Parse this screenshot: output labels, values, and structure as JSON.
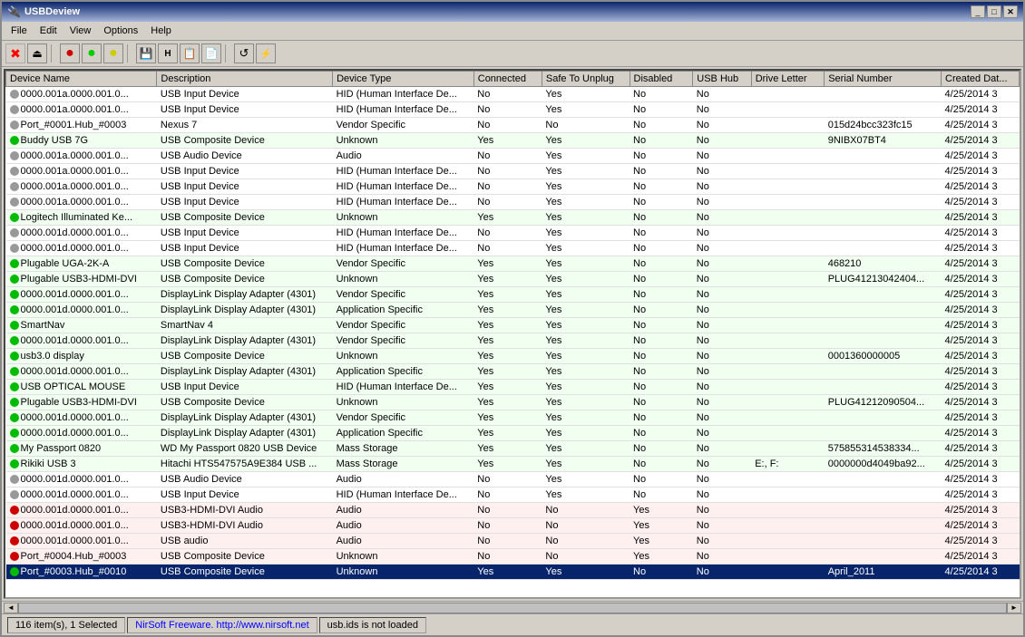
{
  "window": {
    "title": "USBDeview",
    "icon": "💾"
  },
  "menus": [
    "File",
    "Edit",
    "View",
    "Options",
    "Help"
  ],
  "toolbar": {
    "buttons": [
      {
        "icon": "✖",
        "name": "close-btn",
        "color": "red"
      },
      {
        "icon": "⏏",
        "name": "eject-btn"
      },
      {
        "icon": "⚫",
        "name": "dot-red",
        "color": "#cc0000"
      },
      {
        "icon": "⚫",
        "name": "dot-green",
        "color": "#00cc00"
      },
      {
        "icon": "⚫",
        "name": "dot-yellow",
        "color": "#cccc00"
      },
      {
        "icon": "💾",
        "name": "save-btn"
      },
      {
        "icon": "📄",
        "name": "html-btn"
      },
      {
        "icon": "📋",
        "name": "copy-btn"
      },
      {
        "icon": "📊",
        "name": "report-btn"
      },
      {
        "icon": "🔍",
        "name": "find-btn"
      },
      {
        "icon": "🔌",
        "name": "usb-btn"
      },
      {
        "icon": "📦",
        "name": "package-btn"
      }
    ]
  },
  "columns": [
    "Device Name",
    "Description",
    "Device Type",
    "Connected",
    "Safe To Unplug",
    "Disabled",
    "USB Hub",
    "Drive Letter",
    "Serial Number",
    "Created Dat..."
  ],
  "rows": [
    {
      "dot": "gray",
      "name": "0000.001a.0000.001.0...",
      "desc": "USB Input Device",
      "type": "HID (Human Interface De...",
      "connected": "No",
      "safe": "Yes",
      "disabled": "No",
      "hub": "No",
      "drive": "",
      "serial": "",
      "created": "4/25/2014 3"
    },
    {
      "dot": "gray",
      "name": "0000.001a.0000.001.0...",
      "desc": "USB Input Device",
      "type": "HID (Human Interface De...",
      "connected": "No",
      "safe": "Yes",
      "disabled": "No",
      "hub": "No",
      "drive": "",
      "serial": "",
      "created": "4/25/2014 3"
    },
    {
      "dot": "gray",
      "name": "Port_#0001.Hub_#0003",
      "desc": "Nexus 7",
      "type": "Vendor Specific",
      "connected": "No",
      "safe": "No",
      "disabled": "No",
      "hub": "No",
      "drive": "",
      "serial": "015d24bcc323fc15",
      "created": "4/25/2014 3"
    },
    {
      "dot": "green",
      "name": "Buddy USB 7G",
      "desc": "USB Composite Device",
      "type": "Unknown",
      "connected": "Yes",
      "safe": "Yes",
      "disabled": "No",
      "hub": "No",
      "drive": "",
      "serial": "9NIBX07BT4",
      "created": "4/25/2014 3"
    },
    {
      "dot": "gray",
      "name": "0000.001a.0000.001.0...",
      "desc": "USB Audio Device",
      "type": "Audio",
      "connected": "No",
      "safe": "Yes",
      "disabled": "No",
      "hub": "No",
      "drive": "",
      "serial": "",
      "created": "4/25/2014 3"
    },
    {
      "dot": "gray",
      "name": "0000.001a.0000.001.0...",
      "desc": "USB Input Device",
      "type": "HID (Human Interface De...",
      "connected": "No",
      "safe": "Yes",
      "disabled": "No",
      "hub": "No",
      "drive": "",
      "serial": "",
      "created": "4/25/2014 3"
    },
    {
      "dot": "gray",
      "name": "0000.001a.0000.001.0...",
      "desc": "USB Input Device",
      "type": "HID (Human Interface De...",
      "connected": "No",
      "safe": "Yes",
      "disabled": "No",
      "hub": "No",
      "drive": "",
      "serial": "",
      "created": "4/25/2014 3"
    },
    {
      "dot": "gray",
      "name": "0000.001a.0000.001.0...",
      "desc": "USB Input Device",
      "type": "HID (Human Interface De...",
      "connected": "No",
      "safe": "Yes",
      "disabled": "No",
      "hub": "No",
      "drive": "",
      "serial": "",
      "created": "4/25/2014 3"
    },
    {
      "dot": "green",
      "name": "Logitech Illuminated Ke...",
      "desc": "USB Composite Device",
      "type": "Unknown",
      "connected": "Yes",
      "safe": "Yes",
      "disabled": "No",
      "hub": "No",
      "drive": "",
      "serial": "",
      "created": "4/25/2014 3"
    },
    {
      "dot": "gray",
      "name": "0000.001d.0000.001.0...",
      "desc": "USB Input Device",
      "type": "HID (Human Interface De...",
      "connected": "No",
      "safe": "Yes",
      "disabled": "No",
      "hub": "No",
      "drive": "",
      "serial": "",
      "created": "4/25/2014 3"
    },
    {
      "dot": "gray",
      "name": "0000.001d.0000.001.0...",
      "desc": "USB Input Device",
      "type": "HID (Human Interface De...",
      "connected": "No",
      "safe": "Yes",
      "disabled": "No",
      "hub": "No",
      "drive": "",
      "serial": "",
      "created": "4/25/2014 3"
    },
    {
      "dot": "green",
      "name": "Plugable UGA-2K-A",
      "desc": "USB Composite Device",
      "type": "Vendor Specific",
      "connected": "Yes",
      "safe": "Yes",
      "disabled": "No",
      "hub": "No",
      "drive": "",
      "serial": "468210",
      "created": "4/25/2014 3"
    },
    {
      "dot": "green",
      "name": "Plugable USB3-HDMI-DVI",
      "desc": "USB Composite Device",
      "type": "Unknown",
      "connected": "Yes",
      "safe": "Yes",
      "disabled": "No",
      "hub": "No",
      "drive": "",
      "serial": "PLUG41213042404...",
      "created": "4/25/2014 3"
    },
    {
      "dot": "green",
      "name": "0000.001d.0000.001.0...",
      "desc": "DisplayLink Display Adapter (4301)",
      "type": "Vendor Specific",
      "connected": "Yes",
      "safe": "Yes",
      "disabled": "No",
      "hub": "No",
      "drive": "",
      "serial": "",
      "created": "4/25/2014 3"
    },
    {
      "dot": "green",
      "name": "0000.001d.0000.001.0...",
      "desc": "DisplayLink Display Adapter (4301)",
      "type": "Application Specific",
      "connected": "Yes",
      "safe": "Yes",
      "disabled": "No",
      "hub": "No",
      "drive": "",
      "serial": "",
      "created": "4/25/2014 3"
    },
    {
      "dot": "green",
      "name": "SmartNav",
      "desc": "SmartNav 4",
      "type": "Vendor Specific",
      "connected": "Yes",
      "safe": "Yes",
      "disabled": "No",
      "hub": "No",
      "drive": "",
      "serial": "",
      "created": "4/25/2014 3"
    },
    {
      "dot": "green",
      "name": "0000.001d.0000.001.0...",
      "desc": "DisplayLink Display Adapter (4301)",
      "type": "Vendor Specific",
      "connected": "Yes",
      "safe": "Yes",
      "disabled": "No",
      "hub": "No",
      "drive": "",
      "serial": "",
      "created": "4/25/2014 3"
    },
    {
      "dot": "green",
      "name": "usb3.0  display",
      "desc": "USB Composite Device",
      "type": "Unknown",
      "connected": "Yes",
      "safe": "Yes",
      "disabled": "No",
      "hub": "No",
      "drive": "",
      "serial": "0001360000005",
      "created": "4/25/2014 3"
    },
    {
      "dot": "green",
      "name": "0000.001d.0000.001.0...",
      "desc": "DisplayLink Display Adapter (4301)",
      "type": "Application Specific",
      "connected": "Yes",
      "safe": "Yes",
      "disabled": "No",
      "hub": "No",
      "drive": "",
      "serial": "",
      "created": "4/25/2014 3"
    },
    {
      "dot": "green",
      "name": "USB OPTICAL MOUSE",
      "desc": "USB Input Device",
      "type": "HID (Human Interface De...",
      "connected": "Yes",
      "safe": "Yes",
      "disabled": "No",
      "hub": "No",
      "drive": "",
      "serial": "",
      "created": "4/25/2014 3"
    },
    {
      "dot": "green",
      "name": "Plugable USB3-HDMI-DVI",
      "desc": "USB Composite Device",
      "type": "Unknown",
      "connected": "Yes",
      "safe": "Yes",
      "disabled": "No",
      "hub": "No",
      "drive": "",
      "serial": "PLUG41212090504...",
      "created": "4/25/2014 3"
    },
    {
      "dot": "green",
      "name": "0000.001d.0000.001.0...",
      "desc": "DisplayLink Display Adapter (4301)",
      "type": "Vendor Specific",
      "connected": "Yes",
      "safe": "Yes",
      "disabled": "No",
      "hub": "No",
      "drive": "",
      "serial": "",
      "created": "4/25/2014 3"
    },
    {
      "dot": "green",
      "name": "0000.001d.0000.001.0...",
      "desc": "DisplayLink Display Adapter (4301)",
      "type": "Application Specific",
      "connected": "Yes",
      "safe": "Yes",
      "disabled": "No",
      "hub": "No",
      "drive": "",
      "serial": "",
      "created": "4/25/2014 3"
    },
    {
      "dot": "green",
      "name": "My Passport 0820",
      "desc": "WD My Passport 0820 USB Device",
      "type": "Mass Storage",
      "connected": "Yes",
      "safe": "Yes",
      "disabled": "No",
      "hub": "No",
      "drive": "",
      "serial": "575855314538334...",
      "created": "4/25/2014 3"
    },
    {
      "dot": "green",
      "name": "Rikiki USB 3",
      "desc": "Hitachi HTS547575A9E384 USB ...",
      "type": "Mass Storage",
      "connected": "Yes",
      "safe": "Yes",
      "disabled": "No",
      "hub": "No",
      "drive": "E:, F:",
      "serial": "0000000d4049ba92...",
      "created": "4/25/2014 3"
    },
    {
      "dot": "gray",
      "name": "0000.001d.0000.001.0...",
      "desc": "USB Audio Device",
      "type": "Audio",
      "connected": "No",
      "safe": "Yes",
      "disabled": "No",
      "hub": "No",
      "drive": "",
      "serial": "",
      "created": "4/25/2014 3"
    },
    {
      "dot": "gray",
      "name": "0000.001d.0000.001.0...",
      "desc": "USB Input Device",
      "type": "HID (Human Interface De...",
      "connected": "No",
      "safe": "Yes",
      "disabled": "No",
      "hub": "No",
      "drive": "",
      "serial": "",
      "created": "4/25/2014 3"
    },
    {
      "dot": "red",
      "name": "0000.001d.0000.001.0...",
      "desc": "USB3-HDMI-DVI Audio",
      "type": "Audio",
      "connected": "No",
      "safe": "No",
      "disabled": "Yes",
      "hub": "No",
      "drive": "",
      "serial": "",
      "created": "4/25/2014 3"
    },
    {
      "dot": "red",
      "name": "0000.001d.0000.001.0...",
      "desc": "USB3-HDMI-DVI Audio",
      "type": "Audio",
      "connected": "No",
      "safe": "No",
      "disabled": "Yes",
      "hub": "No",
      "drive": "",
      "serial": "",
      "created": "4/25/2014 3"
    },
    {
      "dot": "red",
      "name": "0000.001d.0000.001.0...",
      "desc": "USB audio",
      "type": "Audio",
      "connected": "No",
      "safe": "No",
      "disabled": "Yes",
      "hub": "No",
      "drive": "",
      "serial": "",
      "created": "4/25/2014 3"
    },
    {
      "dot": "red",
      "name": "Port_#0004.Hub_#0003",
      "desc": "USB Composite Device",
      "type": "Unknown",
      "connected": "No",
      "safe": "No",
      "disabled": "Yes",
      "hub": "No",
      "drive": "",
      "serial": "",
      "created": "4/25/2014 3"
    },
    {
      "dot": "selected",
      "name": "Port_#0003.Hub_#0010",
      "desc": "USB Composite Device",
      "type": "Unknown",
      "connected": "Yes",
      "safe": "Yes",
      "disabled": "No",
      "hub": "No",
      "drive": "",
      "serial": "April_2011",
      "created": "4/25/2014 3"
    }
  ],
  "statusbar": {
    "count": "116 item(s), 1 Selected",
    "nirsoft": "NirSoft Freeware.  http://www.nirsoft.net",
    "usb_ids": "usb.ids is not loaded"
  }
}
